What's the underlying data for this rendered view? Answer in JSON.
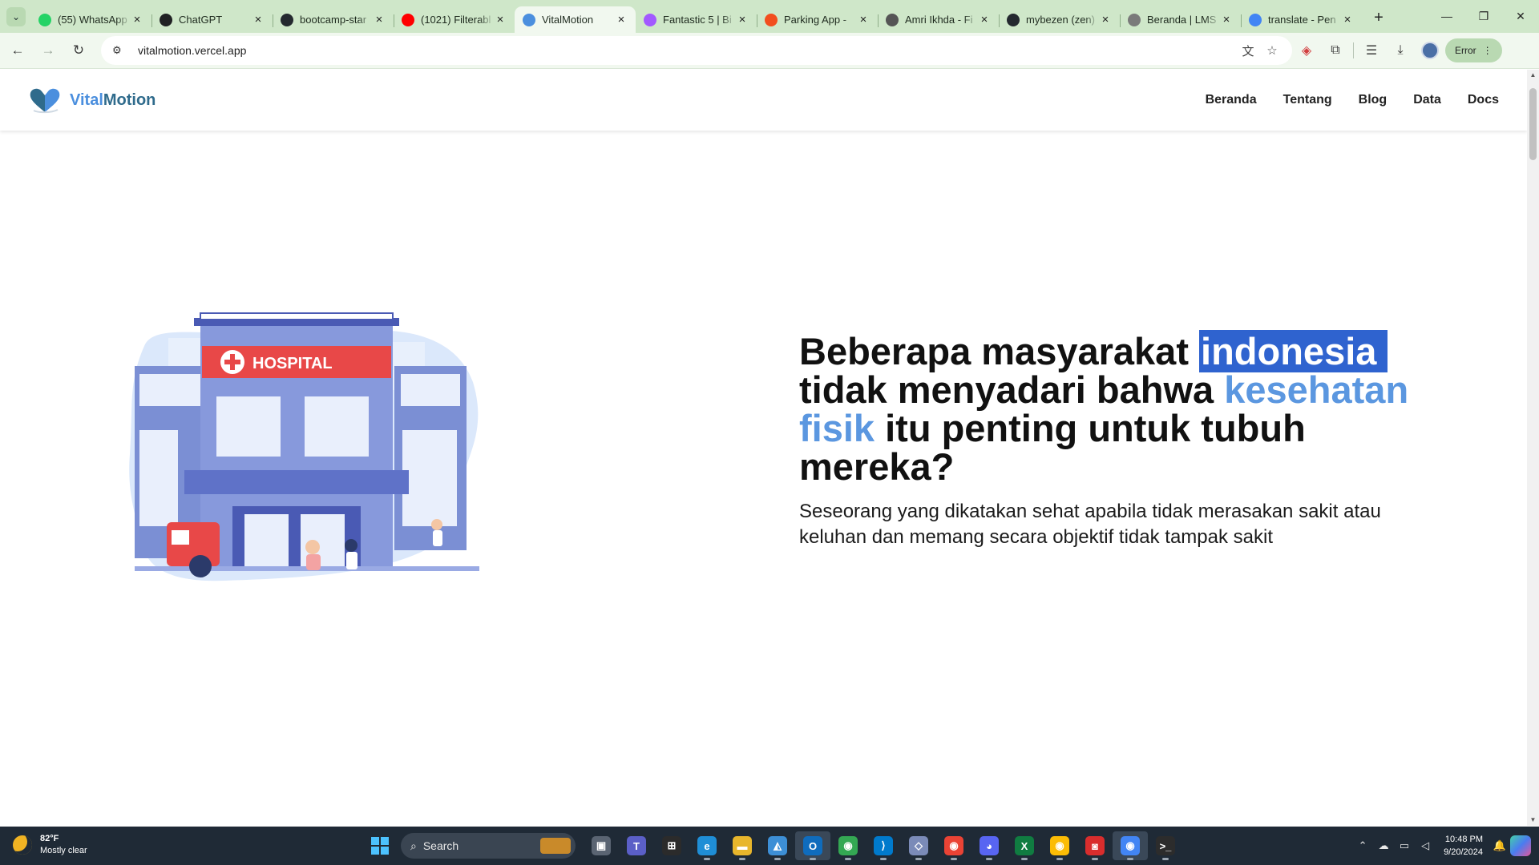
{
  "browser": {
    "tabs": [
      {
        "title": "(55) WhatsApp",
        "favicon": "whatsapp-icon",
        "color": "#25d366",
        "active": false
      },
      {
        "title": "ChatGPT",
        "favicon": "chatgpt-icon",
        "color": "#202123",
        "active": false
      },
      {
        "title": "bootcamp-star",
        "favicon": "github-icon",
        "color": "#24292f",
        "active": false
      },
      {
        "title": "(1021) Filterabl",
        "favicon": "youtube-icon",
        "color": "#ff0000",
        "active": false
      },
      {
        "title": "VitalMotion",
        "favicon": "vitalmotion-icon",
        "color": "#4b8fde",
        "active": true
      },
      {
        "title": "Fantastic 5 | Bi",
        "favicon": "figma-icon",
        "color": "#a259ff",
        "active": false
      },
      {
        "title": "Parking App - ",
        "favicon": "figma-icon",
        "color": "#f24e1e",
        "active": false
      },
      {
        "title": "Amri Ikhda - Fi",
        "favicon": "dash-icon",
        "color": "#555555",
        "active": false
      },
      {
        "title": "mybezen (zen)",
        "favicon": "github-icon",
        "color": "#24292f",
        "active": false
      },
      {
        "title": "Beranda | LMS",
        "favicon": "lms-icon",
        "color": "#7a7a7a",
        "active": false
      },
      {
        "title": "translate - Pen",
        "favicon": "google-icon",
        "color": "#4285f4",
        "active": false
      }
    ],
    "url": "vitalmotion.vercel.app",
    "error_chip": "Error"
  },
  "site": {
    "logo_part1": "Vital",
    "logo_part2": "Motion",
    "brand_colors": {
      "primary": "#4b8fde",
      "secondary": "#2f6b8c"
    },
    "nav": [
      "Beranda",
      "Tentang",
      "Blog",
      "Data",
      "Docs"
    ]
  },
  "hero": {
    "headline_1": "Beberapa masyarakat ",
    "headline_selected": "indonesia",
    "headline_2": " tidak menyadari bahwa ",
    "headline_accent": "kesehatan fisik",
    "headline_3": " itu penting untuk tubuh mereka?",
    "subtitle": "Seseorang yang dikatakan sehat apabila tidak merasakan sakit atau keluhan dan memang secara objektif tidak tampak sakit",
    "illustration_sign": "HOSPITAL",
    "accent_color": "#5b97e0",
    "selection_color": "#2f63cf"
  },
  "taskbar": {
    "weather_temp": "82°F",
    "weather_desc": "Mostly clear",
    "search_placeholder": "Search",
    "apps": [
      {
        "name": "task-view",
        "glyph": "▣",
        "color": "#5a6472"
      },
      {
        "name": "teams",
        "glyph": "T",
        "color": "#5b5fc7"
      },
      {
        "name": "store",
        "glyph": "⊞",
        "color": "#2b2b2b"
      },
      {
        "name": "edge",
        "glyph": "e",
        "color": "#1f8ed6"
      },
      {
        "name": "file-explorer",
        "glyph": "▬",
        "color": "#e8b62c"
      },
      {
        "name": "photos",
        "glyph": "◭",
        "color": "#3d8fd6"
      },
      {
        "name": "outlook",
        "glyph": "O",
        "color": "#0f6cbd"
      },
      {
        "name": "chrome",
        "glyph": "◉",
        "color": "#34a853"
      },
      {
        "name": "vscode",
        "glyph": "⟩",
        "color": "#007acc"
      },
      {
        "name": "git-extension",
        "glyph": "◇",
        "color": "#7b8bb8"
      },
      {
        "name": "chrome-profile",
        "glyph": "◉",
        "color": "#ea4335"
      },
      {
        "name": "discord",
        "glyph": "◕",
        "color": "#5865f2"
      },
      {
        "name": "excel",
        "glyph": "X",
        "color": "#107c41"
      },
      {
        "name": "chrome-profile-2",
        "glyph": "◉",
        "color": "#fbbc05"
      },
      {
        "name": "app-red",
        "glyph": "◙",
        "color": "#d92d2d"
      },
      {
        "name": "chrome-active",
        "glyph": "◉",
        "color": "#4285f4"
      },
      {
        "name": "terminal",
        "glyph": ">_",
        "color": "#2c2c2c"
      }
    ],
    "time": "10:48 PM",
    "date": "9/20/2024"
  }
}
